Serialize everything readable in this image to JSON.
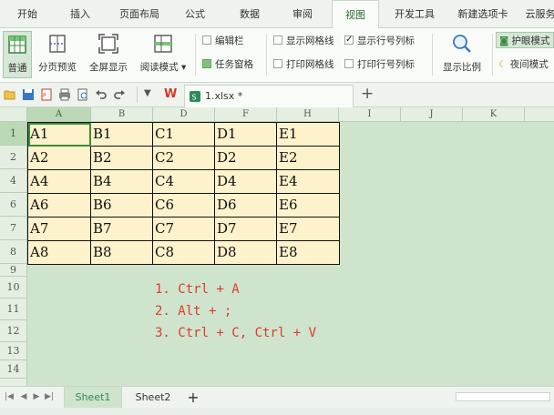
{
  "menu": {
    "tabs": [
      "开始",
      "插入",
      "页面布局",
      "公式",
      "数据",
      "审阅",
      "视图",
      "开发工具",
      "新建选项卡",
      "云服务"
    ],
    "active": "视图"
  },
  "ribbon": {
    "normal": "普通",
    "page_break_preview": "分页预览",
    "full_screen": "全屏显示",
    "reading_mode": "阅读模式",
    "edit_bar": "编辑栏",
    "task_pane": "任务窗格",
    "show_gridlines": "显示网格线",
    "print_gridlines": "打印网格线",
    "show_row_col_headers": "显示行号列标",
    "print_row_col_headers": "打印行号列标",
    "zoom": "显示比例",
    "eye_protection": "护眼模式",
    "night_mode": "夜间模式"
  },
  "quick_access": {
    "file_name": "1.xlsx *",
    "add_tab": "+"
  },
  "sheet": {
    "columns": [
      "A",
      "B",
      "D",
      "F",
      "H",
      "I",
      "J",
      "K"
    ],
    "selected_column": "A",
    "rows": [
      "1",
      "2",
      "4",
      "6",
      "7",
      "8",
      "9",
      "10",
      "11",
      "12",
      "13",
      "14"
    ],
    "selected_row": "1",
    "table": [
      [
        "A1",
        "B1",
        "C1",
        "D1",
        "E1"
      ],
      [
        "A2",
        "B2",
        "C2",
        "D2",
        "E2"
      ],
      [
        "A4",
        "B4",
        "C4",
        "D4",
        "E4"
      ],
      [
        "A6",
        "B6",
        "C6",
        "D6",
        "E6"
      ],
      [
        "A7",
        "B7",
        "C7",
        "D7",
        "E7"
      ],
      [
        "A8",
        "B8",
        "C8",
        "D8",
        "E8"
      ]
    ],
    "notes": [
      "1. Ctrl + A",
      "2. Alt + ;",
      "3. Ctrl + C, Ctrl + V"
    ]
  },
  "sheet_tabs": {
    "tabs": [
      "Sheet1",
      "Sheet2"
    ],
    "active": "Sheet1",
    "add": "+"
  },
  "colors": {
    "accent": "#2e8b57",
    "cell_fill": "#fdf2cc",
    "sheet_background": "#cfe4cc",
    "note_text": "#e03a2a"
  }
}
